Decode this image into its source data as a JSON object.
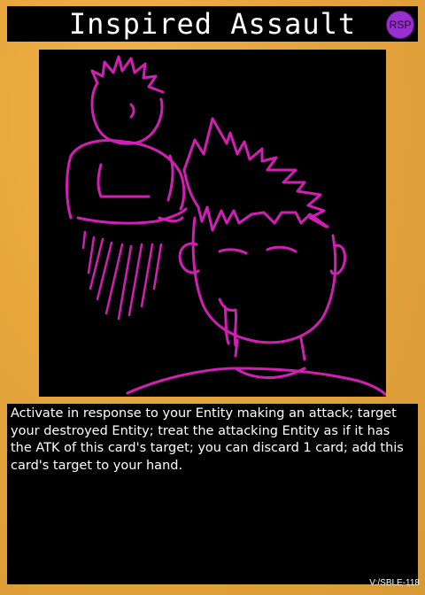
{
  "card": {
    "title": "Inspired Assault",
    "badge": "RSP",
    "effect": "Activate in response to your Entity making an attack; target your destroyed Entity; treat the attacking Entity as if it has the ATK of this card's target; you can discard 1 card; add this card's target to your hand.",
    "set_code": "V:/SBLE-118"
  },
  "colors": {
    "frame": "#e7a53c",
    "panel": "#000000",
    "line_art": "#d11fb4",
    "badge": "#9a2fd1",
    "text": "#ffffff"
  }
}
